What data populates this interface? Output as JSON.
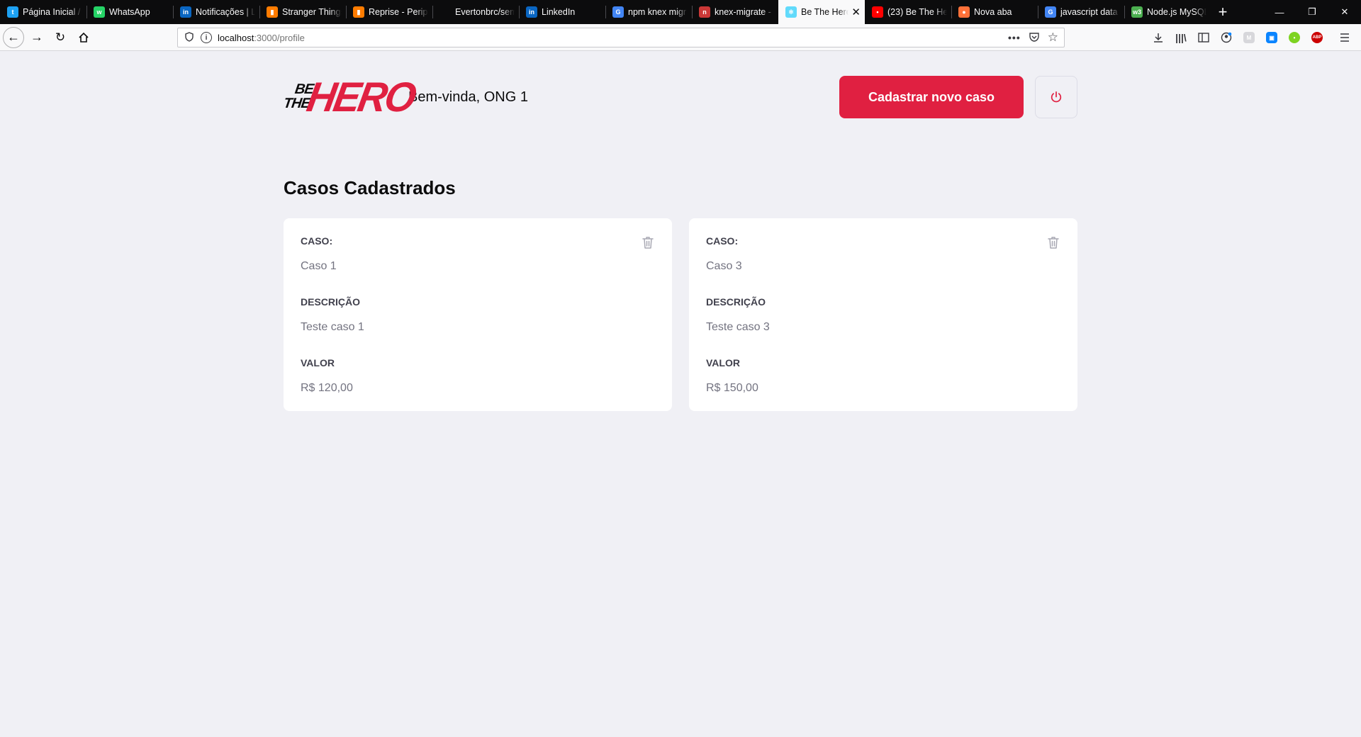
{
  "browser": {
    "tabs": [
      {
        "title": "Página Inicial /",
        "favicon": "twitter-icon",
        "color": "#1da1f2",
        "active": false
      },
      {
        "title": "WhatsApp",
        "favicon": "whatsapp-icon",
        "color": "#25d366",
        "active": false
      },
      {
        "title": "Notificações | L",
        "favicon": "linkedin-icon",
        "color": "#0a66c2",
        "active": false
      },
      {
        "title": "Stranger Things",
        "favicon": "deezer-icon",
        "color": "#ff7c00",
        "active": false
      },
      {
        "title": "Reprise - Periph",
        "favicon": "deezer-icon",
        "color": "#ff7c00",
        "active": false
      },
      {
        "title": "Evertonbrc/sem",
        "favicon": "github-icon",
        "color": "#24292e",
        "active": false
      },
      {
        "title": "LinkedIn",
        "favicon": "linkedin-icon",
        "color": "#0a66c2",
        "active": false
      },
      {
        "title": "npm knex migr",
        "favicon": "google-icon",
        "color": "#4285f4",
        "active": false
      },
      {
        "title": "knex-migrate -",
        "favicon": "npm-icon",
        "color": "#cb3837",
        "active": false
      },
      {
        "title": "Be The Hero",
        "favicon": "react-icon",
        "color": "#61dafb",
        "active": true
      },
      {
        "title": "(23) Be The Her",
        "favicon": "youtube-icon",
        "color": "#ff0000",
        "active": false
      },
      {
        "title": "Nova aba",
        "favicon": "firefox-icon",
        "color": "#ff7139",
        "active": false
      },
      {
        "title": "javascript data",
        "favicon": "google-icon",
        "color": "#4285f4",
        "active": false
      },
      {
        "title": "Node.js MySQL",
        "favicon": "w3schools-icon",
        "color": "#4caf50",
        "active": false
      }
    ],
    "url_host": "localhost",
    "url_path": ":3000/profile"
  },
  "header": {
    "logo_be": "BE",
    "logo_the": "THE",
    "logo_hero": "HERO",
    "welcome": "Bem-vinda, ONG 1",
    "cta_label": "Cadastrar novo caso"
  },
  "main": {
    "title": "Casos Cadastrados",
    "labels": {
      "case": "CASO:",
      "description": "DESCRIÇÃO",
      "value": "VALOR"
    },
    "cases": [
      {
        "case": "Caso 1",
        "description": "Teste caso 1",
        "value": "R$ 120,00"
      },
      {
        "case": "Caso 3",
        "description": "Teste caso 3",
        "value": "R$ 150,00"
      }
    ]
  },
  "colors": {
    "brand": "#e02041",
    "background": "#f0f0f5",
    "card": "#ffffff",
    "label": "#41414d",
    "value": "#737380"
  }
}
